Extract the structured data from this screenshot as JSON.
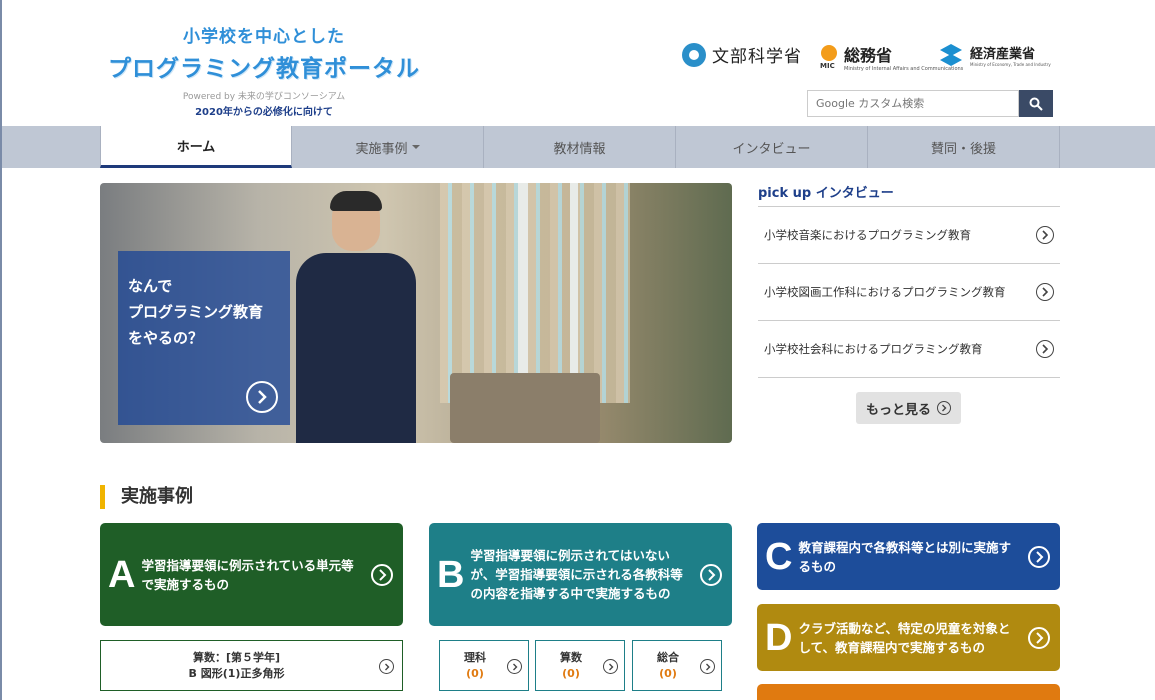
{
  "header": {
    "logo_line1": "小学校を中心とした",
    "logo_line2": "プログラミング教育ポータル",
    "powered_by": "Powered by 未来の学びコンソーシアム",
    "subtitle": "2020年からの必修化に向けて",
    "gov_logos": {
      "mext": "文部科学省",
      "mic_title": "総務省",
      "mic_abbr": "MIC",
      "mic_en": "Ministry of Internal Affairs and Communications",
      "meti_title": "経済産業省",
      "meti_en": "Ministry of Economy, Trade and Industry"
    },
    "search": {
      "placeholder": "Google カスタム検索",
      "icon": "search-icon"
    }
  },
  "nav": {
    "items": [
      {
        "label": "ホーム",
        "active": true
      },
      {
        "label": "実施事例",
        "dropdown": true
      },
      {
        "label": "教材情報"
      },
      {
        "label": "インタビュー"
      },
      {
        "label": "賛同・後援"
      }
    ]
  },
  "hero": {
    "card_text": "なんで\nプログラミング教育\nをやるの？",
    "arrow_icon": "chevron-right-circle-icon"
  },
  "pickup": {
    "title": "pick up インタビュー",
    "items": [
      "小学校音楽におけるプログラミング教育",
      "小学校図画工作科におけるプログラミング教育",
      "小学校社会科におけるプログラミング教育"
    ],
    "more_label": "もっと見る"
  },
  "cases": {
    "title": "実施事例",
    "categories": [
      {
        "letter": "A",
        "text": "学習指導要領に例示されている単元等で実施するもの",
        "color": "#1f5e27"
      },
      {
        "letter": "B",
        "text": "学習指導要領に例示されてはいないが、学習指導要領に示される各教科等の内容を指導する中で実施するもの",
        "color": "#1e7f88"
      },
      {
        "letter": "C",
        "text": "教育課程内で各教科等とは別に実施するもの",
        "color": "#1d4d9a"
      },
      {
        "letter": "D",
        "text": "クラブ活動など、特定の児童を対象として、教育課程内で実施するもの",
        "color": "#b08a10"
      }
    ],
    "sub_a": {
      "line1": "算数：[第５学年]",
      "line2": "B 図形(1)正多角形"
    },
    "sub_b": [
      {
        "label": "理科",
        "count": "(0)"
      },
      {
        "label": "算数",
        "count": "(0)"
      },
      {
        "label": "総合",
        "count": "(0)"
      }
    ],
    "accent": "#e07a10"
  }
}
